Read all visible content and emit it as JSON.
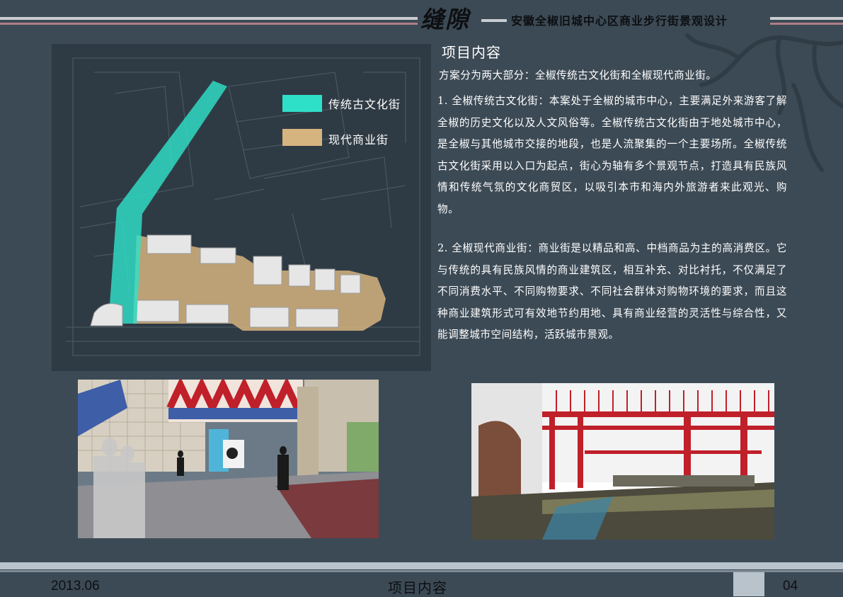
{
  "header": {
    "logo_text": "缝隙",
    "title": "安徽全椒旧城中心区商业步行街景观设计"
  },
  "map": {
    "legend": [
      {
        "label": "传统古文化街",
        "color": "#2fe0c8"
      },
      {
        "label": "现代商业街",
        "color": "#d6b47f"
      }
    ]
  },
  "content": {
    "section_title": "项目内容",
    "intro": "方案分为两大部分：全椒传统古文化街和全椒现代商业街。",
    "para1": "1. 全椒传统古文化街：本案处于全椒的城市中心，主要满足外来游客了解全椒的历史文化以及人文风俗等。全椒传统古文化街由于地处城市中心，是全椒与其他城市交接的地段，也是人流聚集的一个主要场所。全椒传统古文化街采用以入口为起点，街心为轴有多个景观节点，打造具有民族风情和传统气氛的文化商贸区，以吸引本市和海内外旅游者来此观光、购物。",
    "para2": "2. 全椒现代商业街：商业街是以精品和高、中档商品为主的高消费区。它与传统的具有民族风情的商业建筑区，相互补充、对比衬托，不仅满足了不同消费水平、不同购物要求、不同社会群体对购物环境的要求，而且这种商业建筑形式可有效地节约用地、具有商业经营的灵活性与综合性，又能调整城市空间结构，活跃城市景观。"
  },
  "footer": {
    "date": "2013.06",
    "label": "项目内容",
    "page": "04"
  },
  "colors": {
    "background": "#3c4a55",
    "traditional": "#2fe0c8",
    "modern": "#d6b47f",
    "accent_red": "#c0202a"
  }
}
